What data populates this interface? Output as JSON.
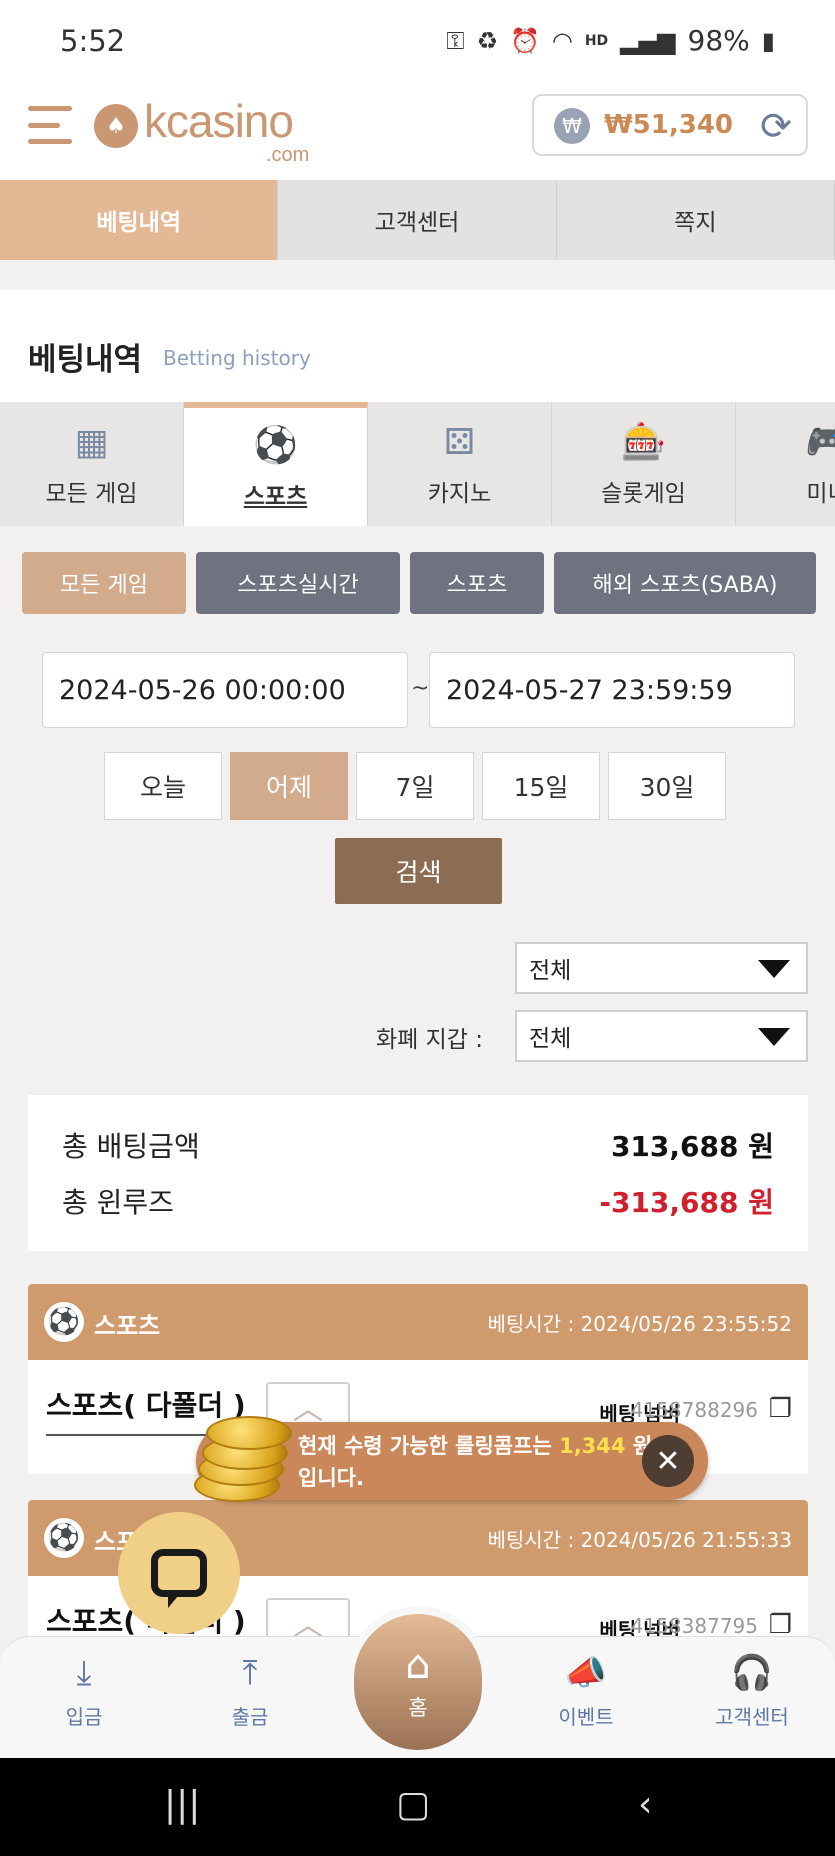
{
  "status_bar": {
    "time": "5:52",
    "battery": "98%",
    "network": "HD",
    "icons": [
      "key-icon",
      "battery-saver-icon",
      "alarm-icon",
      "wifi-icon",
      "signal-icon",
      "battery-icon"
    ]
  },
  "header": {
    "logo_text": "kcasino",
    "logo_sub": ".com",
    "balance": "₩51,340",
    "currency_symbol": "₩"
  },
  "top_tabs": [
    {
      "label": "베팅내역",
      "active": true
    },
    {
      "label": "고객센터",
      "active": false
    },
    {
      "label": "쪽지",
      "active": false
    }
  ],
  "page": {
    "title": "베팅내역",
    "subtitle": "Betting history"
  },
  "game_tabs": [
    {
      "label": "모든 게임",
      "icon": "grid-icon"
    },
    {
      "label": "스포츠",
      "icon": "soccer-ball-icon",
      "active": true
    },
    {
      "label": "카지노",
      "icon": "dice-icon"
    },
    {
      "label": "슬롯게임",
      "icon": "slot-machine-icon"
    },
    {
      "label": "미니",
      "icon": "gamepad-icon"
    }
  ],
  "filters": [
    {
      "label": "모든 게임",
      "active": true
    },
    {
      "label": "스포츠실시간",
      "active": false
    },
    {
      "label": "스포츠",
      "active": false
    },
    {
      "label": "해외 스포츠(SABA)",
      "active": false
    }
  ],
  "date_range": {
    "start": "2024-05-26 00:00:00",
    "separator": "~",
    "end": "2024-05-27 23:59:59"
  },
  "quick_ranges": [
    {
      "label": "오늘",
      "active": false
    },
    {
      "label": "어제",
      "active": true
    },
    {
      "label": "7일",
      "active": false
    },
    {
      "label": "15일",
      "active": false
    },
    {
      "label": "30일",
      "active": false
    }
  ],
  "search_label": "검색",
  "status_select": {
    "value": "전체"
  },
  "wallet_select": {
    "label": "화폐 지갑 :",
    "value": "전체"
  },
  "summary": {
    "total_bet_label": "총 배팅금액",
    "total_bet_value": "313,688 원",
    "total_winloss_label": "총 윈루즈",
    "total_winloss_value": "-313,688 원"
  },
  "bets": [
    {
      "category": "스포츠",
      "time_label": "베팅시간 : 2024/05/26 23:55:52",
      "type": "스포츠( 다폴더 )",
      "number_label": "베팅 넘버",
      "number": "4158788296"
    },
    {
      "category": "스포츠",
      "time_label": "베팅시간 : 2024/05/26 21:55:33",
      "type": "스포츠( 다폴더 )",
      "number_label": "베팅 넘버",
      "number": "4158387795"
    }
  ],
  "toast": {
    "prefix": "현재 수령 가능한 롤링콤프는 ",
    "amount": "1,344",
    "suffix": " 원",
    "line2": "입니다."
  },
  "bottom_nav": {
    "deposit": "입금",
    "withdraw": "출금",
    "home": "홈",
    "event": "이벤트",
    "support": "고객센터"
  },
  "colors": {
    "accent": "#e3b894",
    "card_header": "#cf9a6c",
    "search_button": "#8c6d53",
    "negative": "#d0202e",
    "inactive_filter": "#6f727f",
    "nav_blue": "#5c79a6"
  }
}
